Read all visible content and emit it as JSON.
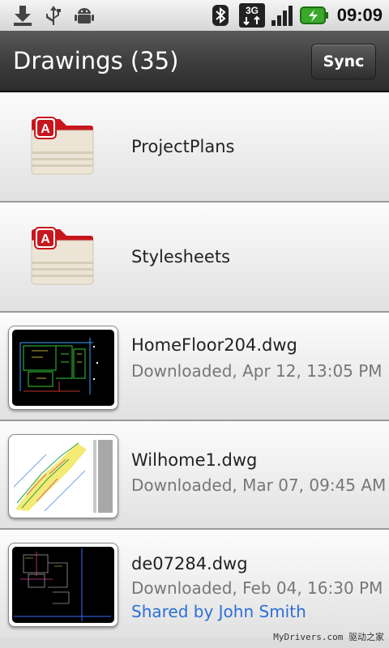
{
  "status_bar": {
    "icons": [
      "download-icon",
      "usb-icon",
      "android-debug-icon",
      "bluetooth-icon",
      "3g-data-icon",
      "signal-strength-icon",
      "battery-charging-icon"
    ],
    "network_label": "3G",
    "time": "09:09"
  },
  "header": {
    "title": "Drawings (35)",
    "sync_label": "Sync"
  },
  "folders": [
    {
      "name": "ProjectPlans",
      "icon": "autocad-folder-icon"
    },
    {
      "name": "Stylesheets",
      "icon": "autocad-folder-icon"
    }
  ],
  "files": [
    {
      "name": "HomeFloor204.dwg",
      "status": "Downloaded, Apr 12, 13:05 PM",
      "shared": ""
    },
    {
      "name": "Wilhome1.dwg",
      "status": "Downloaded, Mar 07, 09:45 AM",
      "shared": ""
    },
    {
      "name": "de07284.dwg",
      "status": "Downloaded, Feb 04, 16:30 PM",
      "shared": "Shared by John Smith"
    }
  ],
  "watermark": "MyDrivers.com 驱动之家",
  "colors": {
    "accent_red": "#c8161d",
    "link_blue": "#2b6fd6",
    "titlebar": "#3e3e3e"
  }
}
